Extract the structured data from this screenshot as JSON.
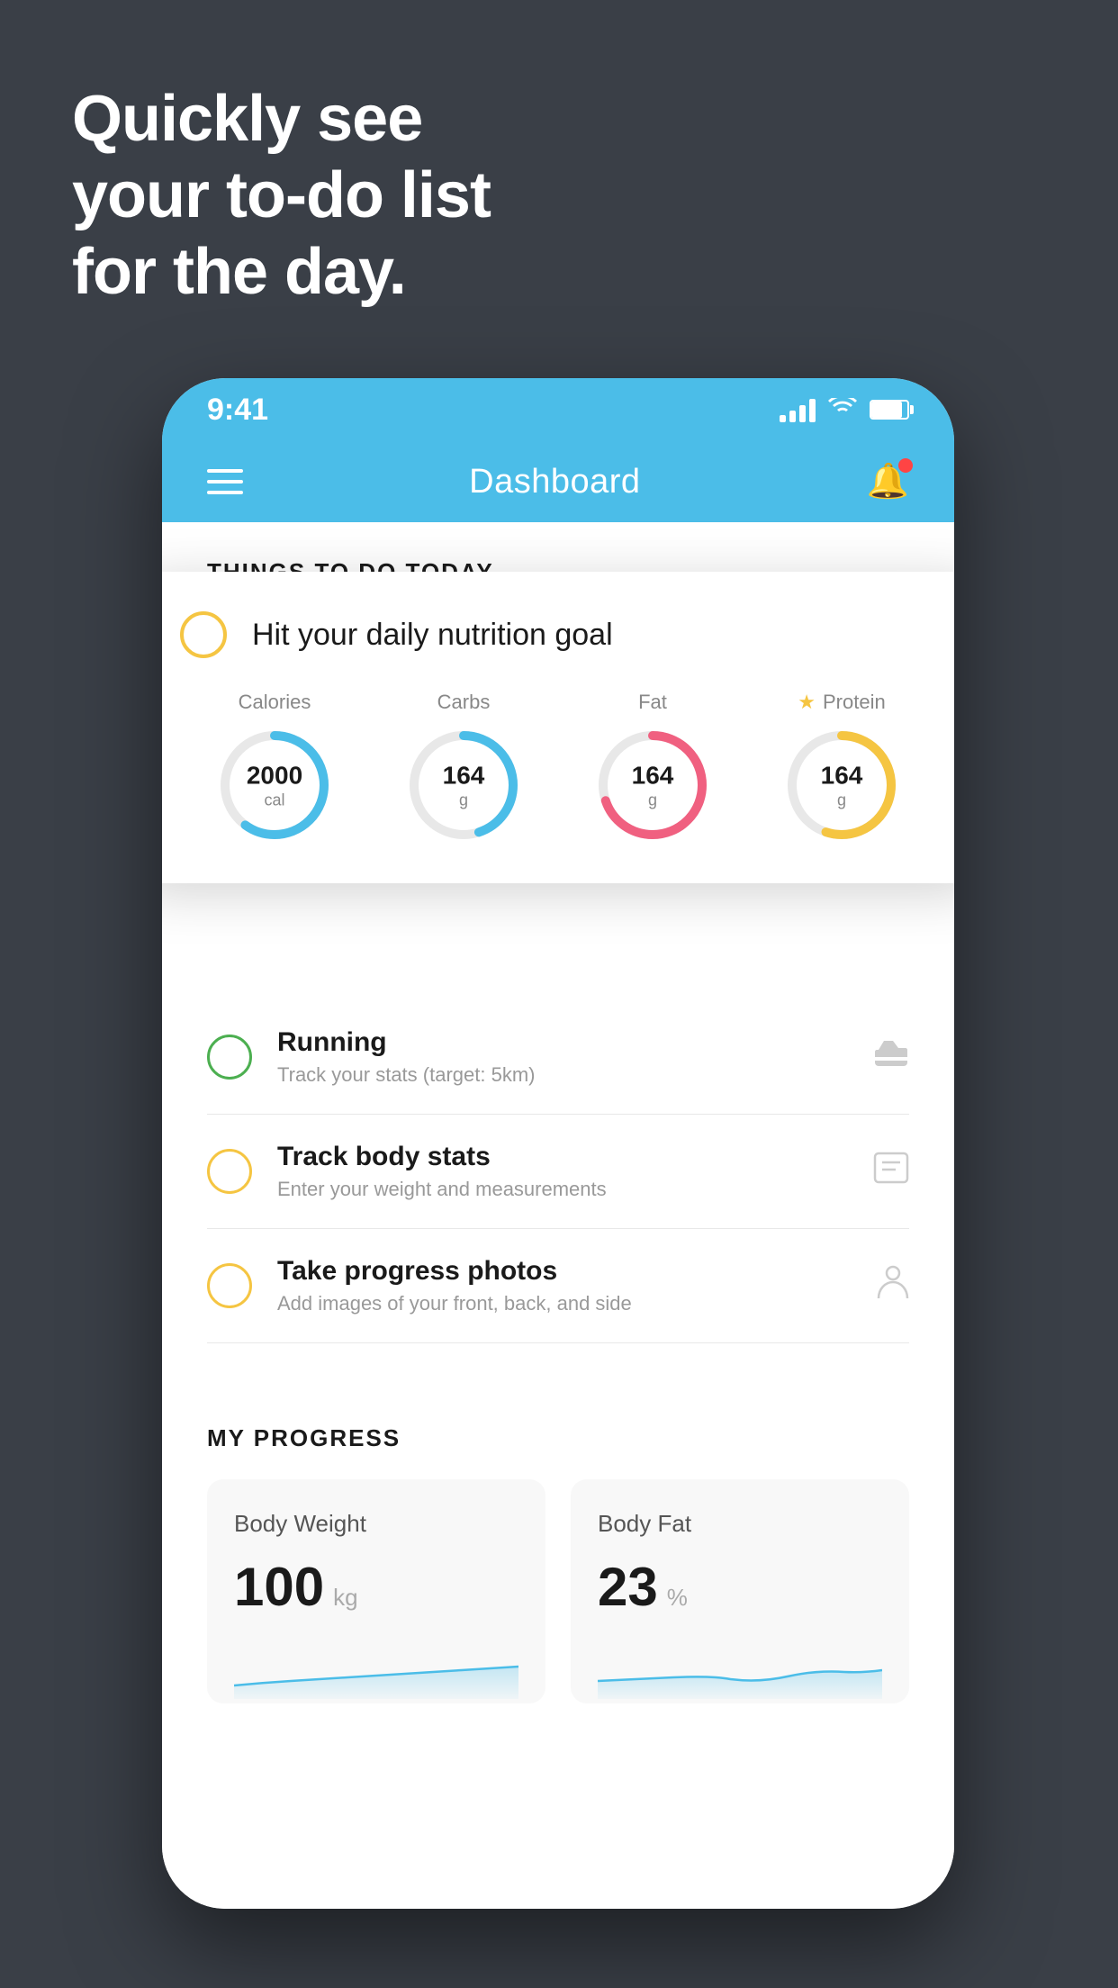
{
  "hero": {
    "line1": "Quickly see",
    "line2": "your to-do list",
    "line3": "for the day."
  },
  "statusBar": {
    "time": "9:41"
  },
  "navbar": {
    "title": "Dashboard"
  },
  "thingsSection": {
    "header": "THINGS TO DO TODAY"
  },
  "nutritionCard": {
    "title": "Hit your daily nutrition goal",
    "items": [
      {
        "label": "Calories",
        "value": "2000",
        "unit": "cal",
        "color": "blue",
        "progress": 60,
        "star": false
      },
      {
        "label": "Carbs",
        "value": "164",
        "unit": "g",
        "color": "blue",
        "progress": 45,
        "star": false
      },
      {
        "label": "Fat",
        "value": "164",
        "unit": "g",
        "color": "pink",
        "progress": 70,
        "star": false
      },
      {
        "label": "Protein",
        "value": "164",
        "unit": "g",
        "color": "yellow",
        "progress": 55,
        "star": true
      }
    ]
  },
  "tasks": [
    {
      "title": "Running",
      "subtitle": "Track your stats (target: 5km)",
      "circleColor": "green",
      "icon": "shoe"
    },
    {
      "title": "Track body stats",
      "subtitle": "Enter your weight and measurements",
      "circleColor": "yellow",
      "icon": "scale"
    },
    {
      "title": "Take progress photos",
      "subtitle": "Add images of your front, back, and side",
      "circleColor": "yellow",
      "icon": "person"
    }
  ],
  "progressSection": {
    "header": "MY PROGRESS",
    "cards": [
      {
        "title": "Body Weight",
        "value": "100",
        "unit": "kg"
      },
      {
        "title": "Body Fat",
        "value": "23",
        "unit": "%"
      }
    ]
  }
}
